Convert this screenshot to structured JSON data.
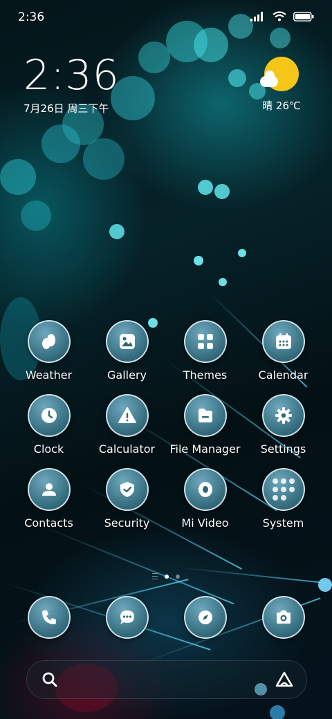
{
  "status_bar": {
    "time": "2:36"
  },
  "clock_widget": {
    "time": "2:36",
    "date": "7月26日 周三下午"
  },
  "weather_widget": {
    "condition_temp": "晴 26℃"
  },
  "apps": [
    {
      "label": "Weather",
      "icon": "weather-icon"
    },
    {
      "label": "Gallery",
      "icon": "gallery-icon"
    },
    {
      "label": "Themes",
      "icon": "themes-icon"
    },
    {
      "label": "Calendar",
      "icon": "calendar-icon"
    },
    {
      "label": "Clock",
      "icon": "clock-icon"
    },
    {
      "label": "Calculator",
      "icon": "calculator-icon"
    },
    {
      "label": "File Manager",
      "icon": "file-manager-icon"
    },
    {
      "label": "Settings",
      "icon": "settings-icon"
    },
    {
      "label": "Contacts",
      "icon": "contacts-icon"
    },
    {
      "label": "Security",
      "icon": "security-icon"
    },
    {
      "label": "Mi Video",
      "icon": "mi-video-icon"
    },
    {
      "label": "System",
      "icon": "system-folder-icon"
    }
  ],
  "dock": [
    {
      "icon": "phone-icon"
    },
    {
      "icon": "messages-icon"
    },
    {
      "icon": "browser-icon"
    },
    {
      "icon": "camera-icon"
    }
  ],
  "page_indicator": {
    "pages": 2,
    "active": 0
  },
  "colors": {
    "sun": "#f5c518",
    "icon_bg": "#2e6677",
    "icon_border": "#e6f5fa"
  }
}
